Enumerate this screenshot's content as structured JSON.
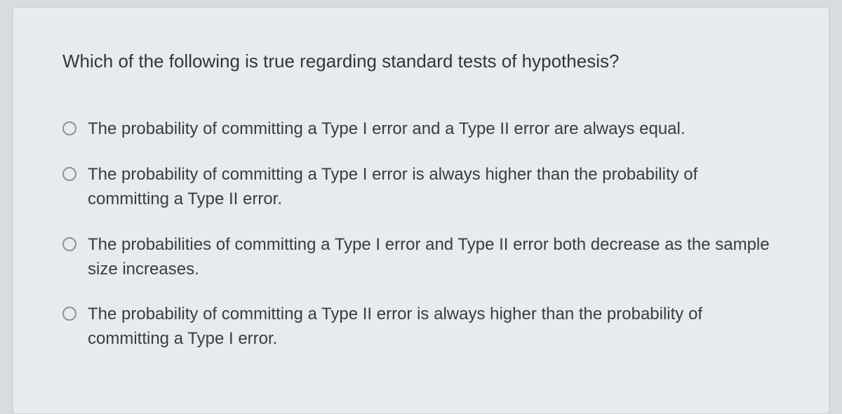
{
  "question": {
    "prompt": "Which of the following is true regarding standard tests of hypothesis?",
    "options": [
      {
        "label": "The probability of committing a Type I error and a Type II error are always equal."
      },
      {
        "label": "The probability of committing a Type I error is always higher than the probability of committing a Type II error."
      },
      {
        "label": "The probabilities of committing a Type I error and Type II error both decrease as the sample size increases."
      },
      {
        "label": "The probability of committing a Type II error is always higher than the probability of committing a Type I error."
      }
    ]
  }
}
